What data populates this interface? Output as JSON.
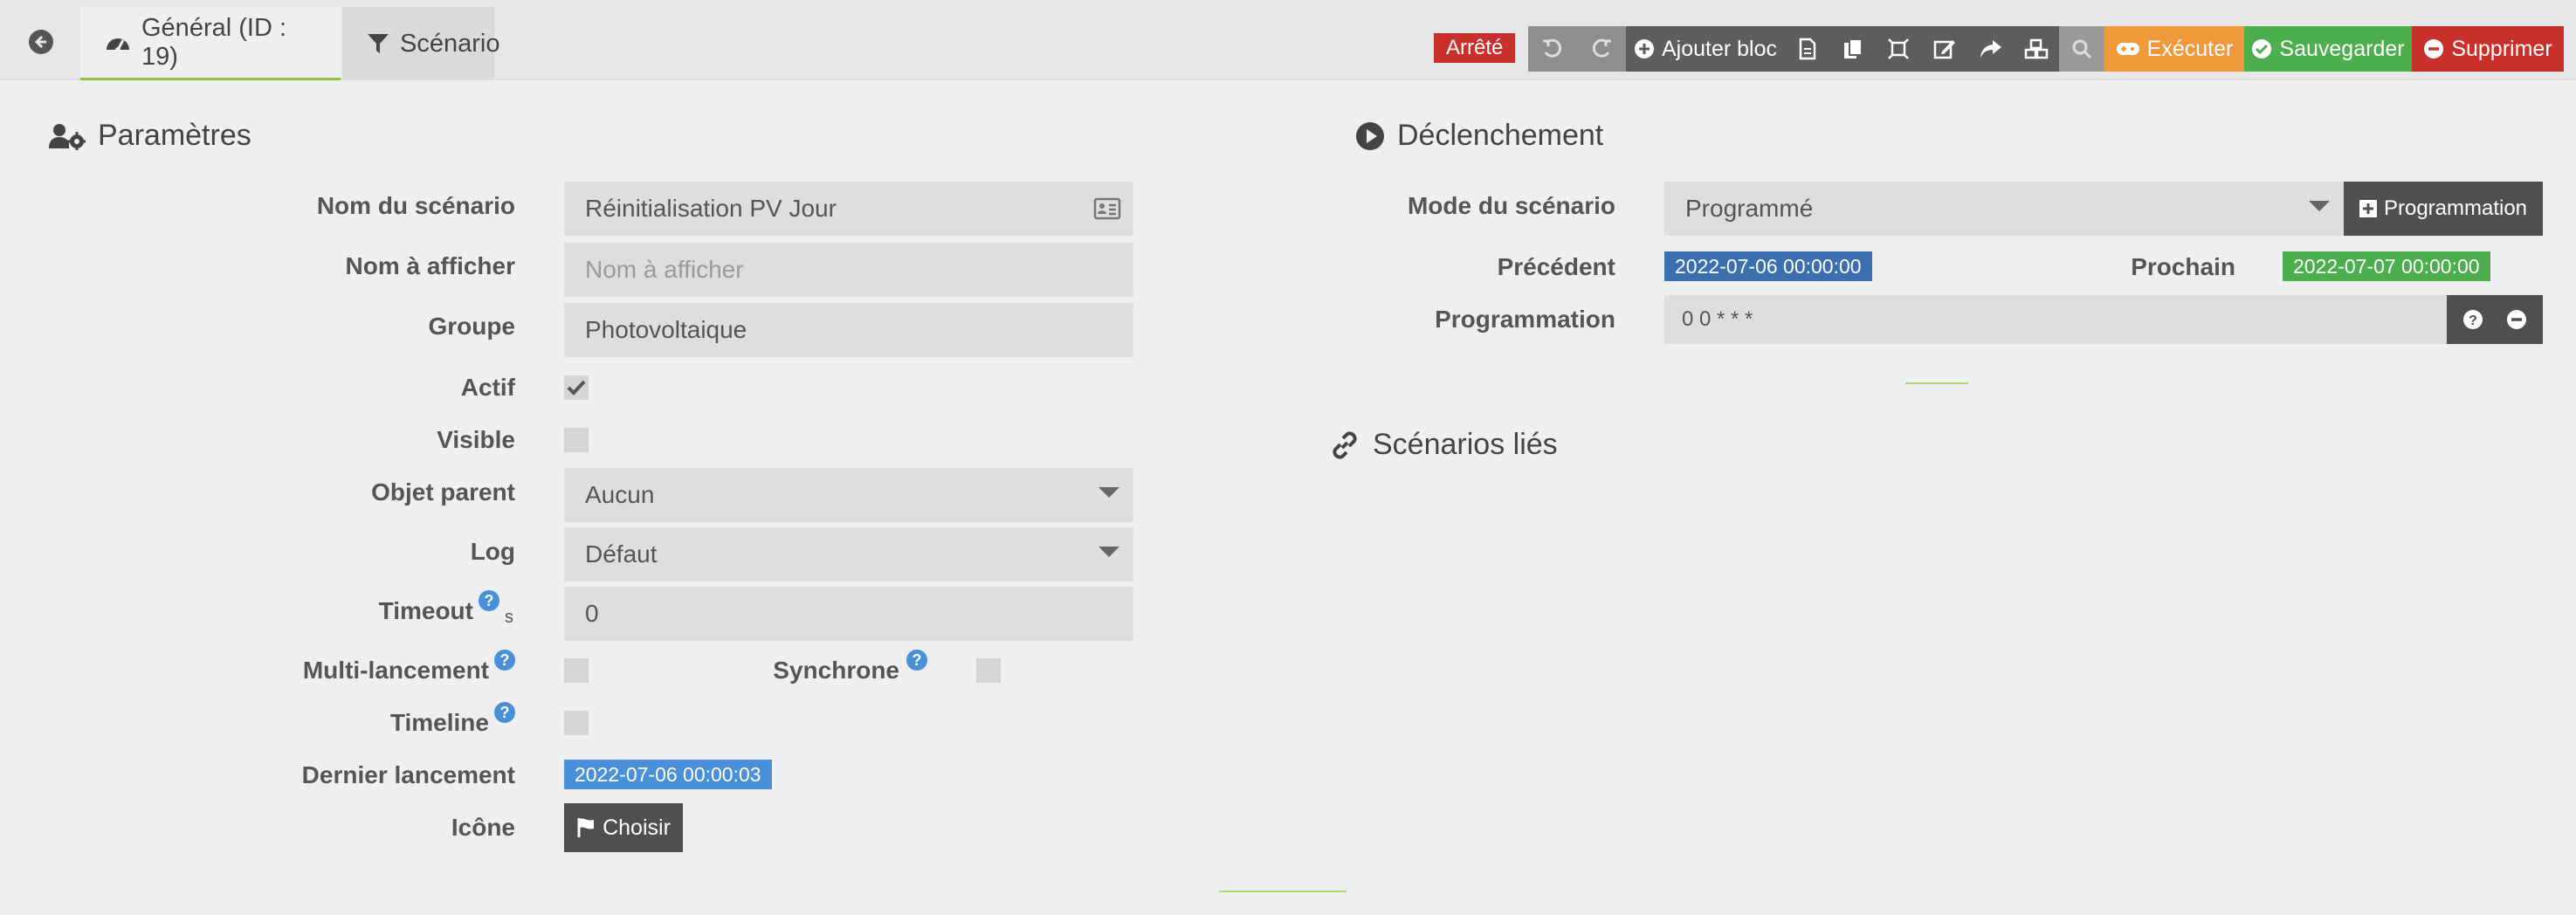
{
  "tabs": {
    "general": "Général (ID : 19)",
    "scenario": "Scénario"
  },
  "toolbar": {
    "status": "Arrêté",
    "add_block": "Ajouter bloc",
    "execute": "Exécuter",
    "save": "Sauvegarder",
    "delete": "Supprimer"
  },
  "params": {
    "title": "Paramètres",
    "name_label": "Nom du scénario",
    "name_value": "Réinitialisation PV Jour",
    "display_label": "Nom à afficher",
    "display_placeholder": "Nom à afficher",
    "group_label": "Groupe",
    "group_value": "Photovoltaique",
    "active_label": "Actif",
    "visible_label": "Visible",
    "parent_label": "Objet parent",
    "parent_value": "Aucun",
    "log_label": "Log",
    "log_value": "Défaut",
    "timeout_label": "Timeout",
    "timeout_unit": "s",
    "timeout_value": "0",
    "multi_label": "Multi-lancement",
    "sync_label": "Synchrone",
    "timeline_label": "Timeline",
    "last_label": "Dernier lancement",
    "last_value": "2022-07-06 00:00:03",
    "icon_label": "Icône",
    "choose_label": "Choisir"
  },
  "trigger": {
    "title": "Déclenchement",
    "mode_label": "Mode du scénario",
    "mode_value": "Programmé",
    "programmation_button": "Programmation",
    "prev_label": "Précédent",
    "prev_value": "2022-07-06 00:00:00",
    "next_label": "Prochain",
    "next_value": "2022-07-07 00:00:00",
    "prog_label": "Programmation",
    "prog_value": "0 0 * * *"
  },
  "linked": {
    "title": "Scénarios liés"
  },
  "colors": {
    "status_red": "#c9302c",
    "date_blue": "#3a6fb0",
    "date_green": "#4cae4c",
    "last_run_blue": "#4a90d9",
    "execute_orange": "#f0993a",
    "accent_green": "#8fbf3b"
  }
}
